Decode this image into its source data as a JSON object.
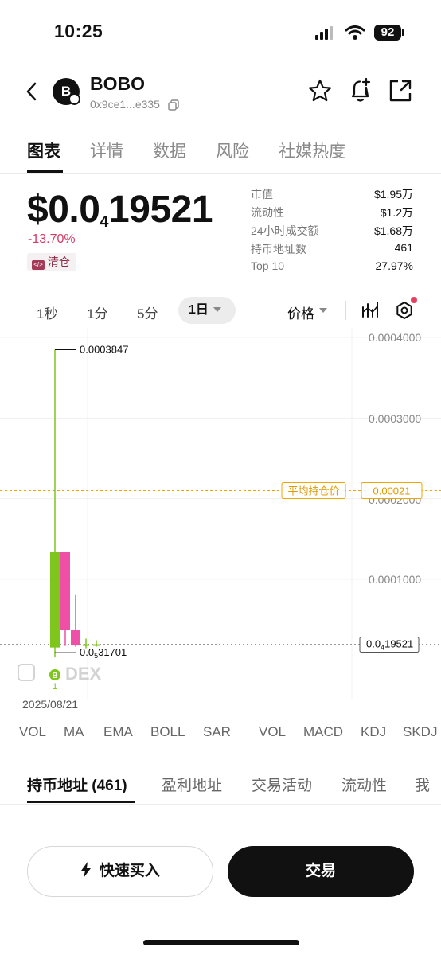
{
  "status_bar": {
    "time": "10:25",
    "battery": "92"
  },
  "header": {
    "avatar_letter": "B",
    "token_name": "BOBO",
    "token_address": "0x9ce1...e335"
  },
  "tabs": [
    {
      "label": "图表",
      "active": true
    },
    {
      "label": "详情"
    },
    {
      "label": "数据"
    },
    {
      "label": "风险"
    },
    {
      "label": "社媒热度"
    }
  ],
  "price": {
    "prefix": "$0.0",
    "subscript": "4",
    "digits": "19521",
    "change": "-13.70%",
    "badge_icon": "</>",
    "badge_label": "清仓"
  },
  "stats": [
    {
      "label": "市值",
      "value": "$1.95万"
    },
    {
      "label": "流动性",
      "value": "$1.2万"
    },
    {
      "label": "24小时成交额",
      "value": "$1.68万"
    },
    {
      "label": "持币地址数",
      "value": "461"
    },
    {
      "label": "Top 10",
      "value": "27.97%"
    }
  ],
  "timeframes": {
    "t1s": "1秒",
    "t1m": "1分",
    "t5m": "5分",
    "t1d": "1日",
    "price_toggle": "价格"
  },
  "chart_data": {
    "type": "candlestick",
    "y_ticks": [
      "0.0004000",
      "0.0003000",
      "0.0001000"
    ],
    "y_ticks_values": [
      0.0004,
      0.0003,
      0.0001
    ],
    "partial_tick": "0.0002000",
    "ylim": [
      1e-05,
      0.0004
    ],
    "high_label": "0.0003847",
    "low_label_prefix": "0.0",
    "low_label_sub": "5",
    "low_label_digits": "31701",
    "avg_cost_label": "平均持仓价",
    "avg_cost_value": "0.00021",
    "avg_cost": 0.00021,
    "current_label_prefix": "0.0",
    "current_label_sub": "4",
    "current_label_digits": "19521",
    "current_price": 1.9521e-05,
    "watermark": "DEX",
    "marker_letter": "B",
    "marker_count": "1",
    "candles": [
      {
        "open": 1.55e-05,
        "high": 0.0003847,
        "low": 3.2e-06,
        "close": 0.000134,
        "color": "#7ec51c"
      },
      {
        "open": 0.000134,
        "high": 0.000115,
        "low": 1.75e-05,
        "close": 3.75e-05,
        "color": "#ef4fa6"
      },
      {
        "open": 3.75e-05,
        "high": 8.05e-05,
        "low": 1.65e-05,
        "close": 1.8e-05,
        "color": "#ef4fa6"
      },
      {
        "open": 1.8e-05,
        "high": 2.65e-05,
        "low": 1.45e-05,
        "close": 1.95e-05,
        "color": "#7ec51c"
      },
      {
        "open": 1.95e-05,
        "high": 2.45e-05,
        "low": 1.65e-05,
        "close": 1.95e-05,
        "color": "#7ec51c"
      }
    ],
    "date": "2025/08/21"
  },
  "indicators": [
    "VOL",
    "MA",
    "EMA",
    "BOLL",
    "SAR",
    "VOL",
    "MACD",
    "KDJ",
    "SKDJ"
  ],
  "bottom_tabs": [
    {
      "label": "持币地址 (461)",
      "active": true
    },
    {
      "label": "盈利地址"
    },
    {
      "label": "交易活动"
    },
    {
      "label": "流动性"
    },
    {
      "label": "我"
    }
  ],
  "actions": {
    "quick_buy": "快速买入",
    "trade": "交易"
  },
  "colors": {
    "up": "#7ec51c",
    "down": "#ef4fa6",
    "accent_red": "#d33b66",
    "avg_cost": "#f0a500"
  }
}
